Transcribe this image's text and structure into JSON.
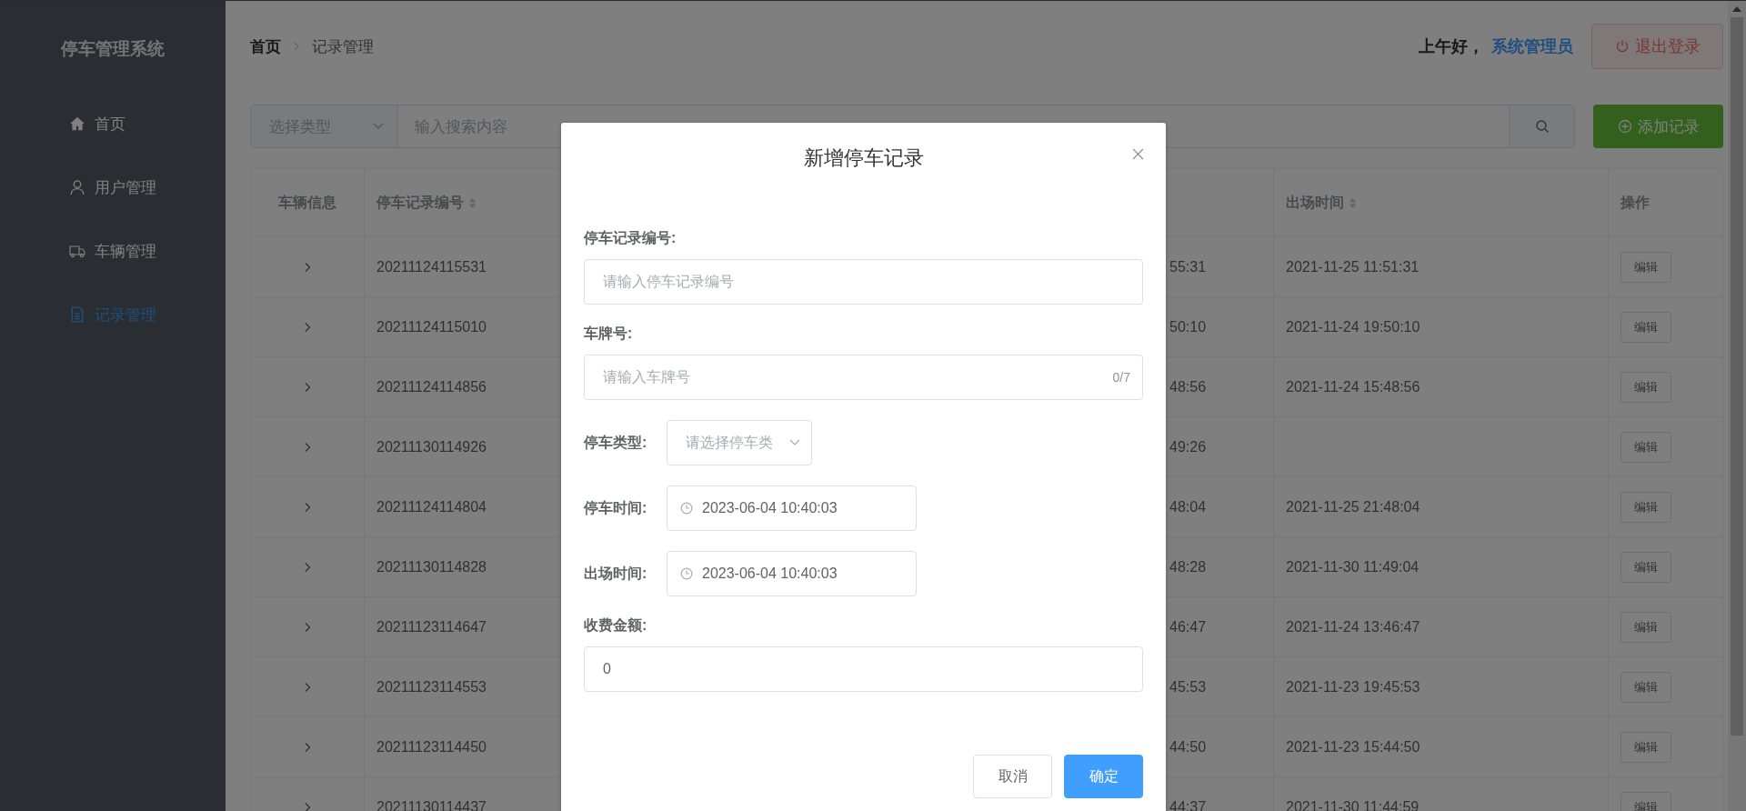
{
  "sidebar": {
    "title": "停车管理系统",
    "items": [
      {
        "label": "首页",
        "selected": false
      },
      {
        "label": "用户管理",
        "selected": false
      },
      {
        "label": "车辆管理",
        "selected": false
      },
      {
        "label": "记录管理",
        "selected": true
      }
    ]
  },
  "breadcrumb": [
    "首页",
    "记录管理"
  ],
  "greeting": "上午好，",
  "user_name": "系统管理员",
  "logout_button": "退出登录",
  "search": {
    "type_placeholder": "选择类型",
    "placeholder": "输入搜索内容"
  },
  "add_button": "添加记录",
  "table": {
    "columns": [
      {
        "label": "车辆信息",
        "sortable": false
      },
      {
        "label": "停车记录编号",
        "sortable": true
      },
      {
        "label": "出场时间",
        "sortable": true
      },
      {
        "label": "操作",
        "sortable": false
      }
    ],
    "rows": [
      {
        "id": "20211124115531",
        "column_3": "55:31",
        "exit": "2021-11-25 11:51:31",
        "action": "编辑"
      },
      {
        "id": "20211124115010",
        "column_3": "50:10",
        "exit": "2021-11-24 19:50:10",
        "action": "编辑"
      },
      {
        "id": "20211124114856",
        "column_3": "48:56",
        "exit": "2021-11-24 15:48:56",
        "action": "编辑"
      },
      {
        "id": "20211130114926",
        "column_3": "49:26",
        "action": "编辑"
      },
      {
        "id": "20211124114804",
        "column_3": "48:04",
        "exit": "2021-11-25 21:48:04",
        "action": "编辑"
      },
      {
        "id": "20211130114828",
        "column_3": "48:28",
        "exit": "2021-11-30 11:49:04",
        "action": "编辑"
      },
      {
        "id": "20211123114647",
        "column_3": "46:47",
        "exit": "2021-11-24 13:46:47",
        "action": "编辑"
      },
      {
        "id": "20211123114553",
        "column_3": "45:53",
        "exit": "2021-11-23 19:45:53",
        "action": "编辑"
      },
      {
        "id": "20211123114450",
        "column_3": "44:50",
        "exit": "2021-11-23 15:44:50",
        "action": "编辑"
      },
      {
        "id": "20211130114437",
        "column_3": "44:37",
        "exit": "2021-11-30 11:44:59",
        "action": "编辑"
      }
    ]
  },
  "dialog": {
    "title": "新增停车记录",
    "fields": [
      {
        "kind": "text",
        "label": "停车记录编号:",
        "placeholder": "请输入停车记录编号"
      },
      {
        "kind": "text",
        "label": "车牌号:",
        "placeholder": "请输入车牌号",
        "counter": "0/7"
      },
      {
        "kind": "select",
        "label": "停车类型:",
        "placeholder": "请选择停车类"
      },
      {
        "kind": "datetime",
        "label": "停车时间:",
        "value": "2023-06-04 10:40:03"
      },
      {
        "kind": "datetime",
        "label": "出场时间:",
        "value": "2023-06-04 10:40:03"
      },
      {
        "kind": "text",
        "label": "收费金额:",
        "value": "0"
      }
    ],
    "buttons": [
      {
        "label": "取消",
        "primary": false
      },
      {
        "label": "确定",
        "primary": true
      }
    ]
  }
}
